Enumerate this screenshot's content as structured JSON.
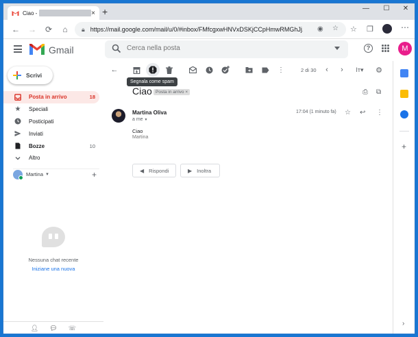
{
  "browser": {
    "tab_title": "Ciao -",
    "tab_close": "×",
    "new_tab": "+",
    "minimize": "—",
    "maximize": "☐",
    "close": "✕",
    "url": "https://mail.google.com/mail/u/0/#inbox/FMfcgxwHNVxDSKjCCpHmwRMGhJj..."
  },
  "gmail": {
    "brand": "Gmail",
    "search_placeholder": "Cerca nella posta",
    "avatar_initial": "M",
    "brand_colors": {
      "red": "#ea4335",
      "blue": "#4285f4",
      "green": "#34a853",
      "yellow": "#fbbc04"
    }
  },
  "sidebar": {
    "compose_label": "Scrivi",
    "items": [
      {
        "label": "Posta in arrivo",
        "count": "18",
        "icon": "inbox-icon",
        "active": true
      },
      {
        "label": "Speciali",
        "count": "",
        "icon": "star-icon"
      },
      {
        "label": "Posticipati",
        "count": "",
        "icon": "clock-icon"
      },
      {
        "label": "Inviati",
        "count": "",
        "icon": "send-icon"
      },
      {
        "label": "Bozze",
        "count": "10",
        "icon": "draft-icon",
        "bold": true
      },
      {
        "label": "Altro",
        "count": "",
        "icon": "chevron-down-icon"
      }
    ],
    "hangouts_user": "Martina",
    "chat_empty_text": "Nessuna chat recente",
    "chat_link": "Iniziane una nuova"
  },
  "toolbar": {
    "tooltip": "Segnala come spam",
    "pager": "2 di 30"
  },
  "message": {
    "subject": "Ciao",
    "label": "Posta in arrivo",
    "label_remove": "×",
    "sender": "Martina Oliva",
    "to": "a me",
    "time": "17:04 (1 minuto fa)",
    "body": "Ciao",
    "signature": "Martina",
    "reply_label": "Rispondi",
    "forward_label": "Inoltra"
  }
}
